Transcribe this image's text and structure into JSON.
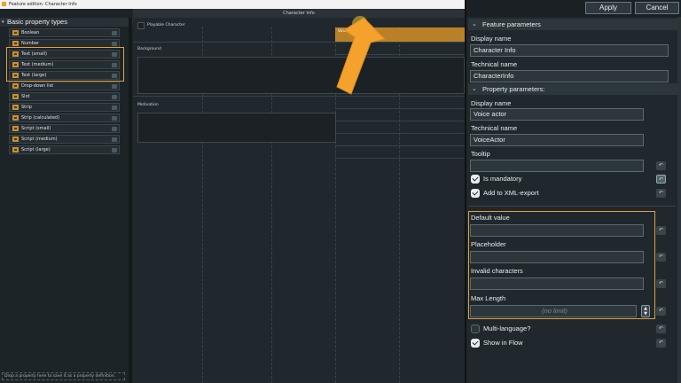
{
  "window": {
    "title": "Feature edition: Character Info"
  },
  "left_panel": {
    "header": "Basic property types",
    "items": [
      {
        "label": "Boolean"
      },
      {
        "label": "Number"
      },
      {
        "label": "Text (small)"
      },
      {
        "label": "Text (medium)"
      },
      {
        "label": "Text (large)"
      },
      {
        "label": "Drop-down list"
      },
      {
        "label": "Slot"
      },
      {
        "label": "Strip"
      },
      {
        "label": "Strip (calculated)"
      },
      {
        "label": "Script (small)"
      },
      {
        "label": "Script (medium)"
      },
      {
        "label": "Script (large)"
      }
    ],
    "drop_hint": "Drop a property here to save it as a property definition."
  },
  "canvas": {
    "header": "Character Info",
    "playable_label": "Playable Character",
    "voice_actor_label": "Voice actor",
    "background_label": "Background",
    "motivation_label": "Motivation"
  },
  "toolbar": {
    "apply_label": "Apply",
    "cancel_label": "Cancel"
  },
  "feature_params": {
    "title": "Feature parameters",
    "display_name_label": "Display name",
    "display_name_value": "Character Info",
    "technical_name_label": "Technical name",
    "technical_name_value": "CharacterInfo"
  },
  "property_params": {
    "title": "Property parameters:",
    "display_name_label": "Display name",
    "display_name_value": "Voice actor",
    "technical_name_label": "Technical name",
    "technical_name_value": "VoiceActor",
    "tooltip_label": "Tooltip",
    "tooltip_value": "",
    "is_mandatory_label": "Is mandatory",
    "xml_export_label": "Add to XML-export",
    "default_value_label": "Default value",
    "default_value": "",
    "placeholder_label": "Placeholder",
    "placeholder_value": "",
    "invalid_chars_label": "Invalid characters",
    "invalid_chars_value": "",
    "max_length_label": "Max Length",
    "max_length_placeholder": "(no limit)",
    "multi_language_label": "Multi-language?",
    "show_in_flow_label": "Show in Flow"
  },
  "icons": {
    "reset": "↶",
    "stepper_up": "▲",
    "stepper_down": "▼",
    "collapse": "⌄",
    "tree_collapse": "▾"
  },
  "colors": {
    "accent": "#e3a13b",
    "voice_field": "#b98028",
    "arrow": "#f4a22c"
  }
}
